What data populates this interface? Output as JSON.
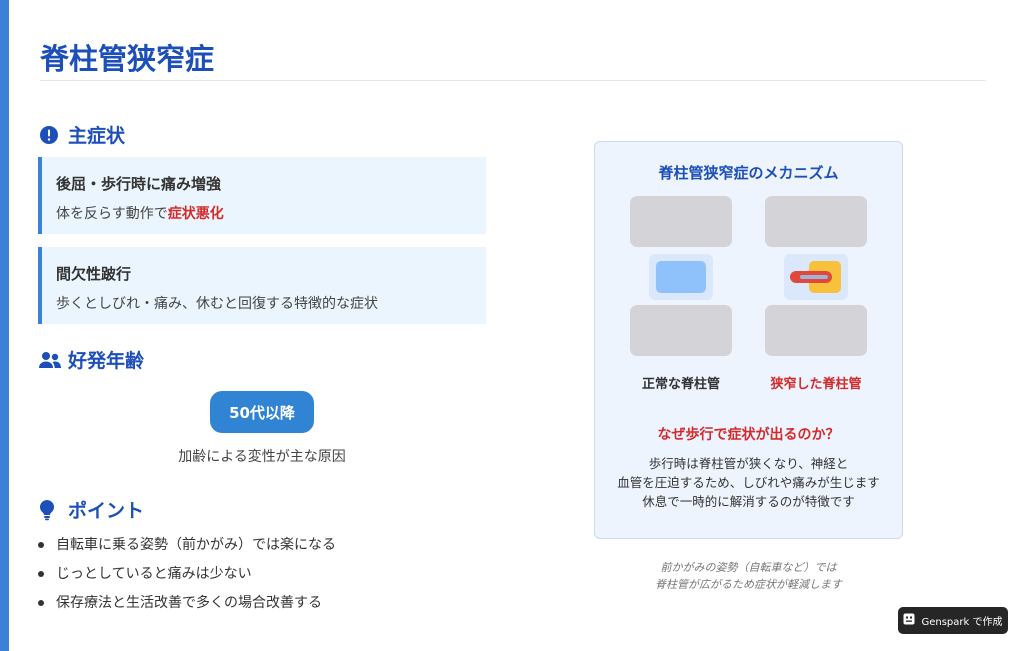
{
  "page": {
    "title": "脊柱管狭窄症"
  },
  "symptoms": {
    "heading": "主症状",
    "cards": [
      {
        "title": "後屈・歩行時に痛み増強",
        "text_prefix": "体を反らす動作で",
        "text_highlight": "症状悪化"
      },
      {
        "title": "間欠性跛行",
        "text_prefix": "歩くとしびれ・痛み、休むと回復する特徴的な症状",
        "text_highlight": ""
      }
    ]
  },
  "age": {
    "heading": "好発年齢",
    "badge": "50代以降",
    "note": "加齢による変性が主な原因"
  },
  "points": {
    "heading": "ポイント",
    "items": [
      "自転車に乗る姿勢（前かがみ）では楽になる",
      "じっとしていると痛みは少ない",
      "保存療法と生活改善で多くの場合改善する"
    ]
  },
  "mechanism": {
    "title": "脊柱管狭窄症のメカニズム",
    "normal_label": "正常な脊柱管",
    "narrow_label": "狭窄した脊柱管",
    "why_title": "なぜ歩行で症状が出るのか？",
    "why_lines": [
      "歩行時は脊柱管が狭くなり、神経と",
      "血管を圧迫するため、しびれや痛みが生じます",
      "休息で一時的に解消するのが特徴です"
    ]
  },
  "caption": {
    "lines": [
      "前かがみの姿勢（自転車など）では",
      "脊柱管が広がるため症状が軽減します"
    ]
  },
  "badge": {
    "label": "Genspark で作成"
  },
  "colors": {
    "accent": "#3b82d6",
    "heading": "#1d4fb8",
    "highlight": "#d42a2a",
    "card_bg": "#ebf5fd"
  }
}
